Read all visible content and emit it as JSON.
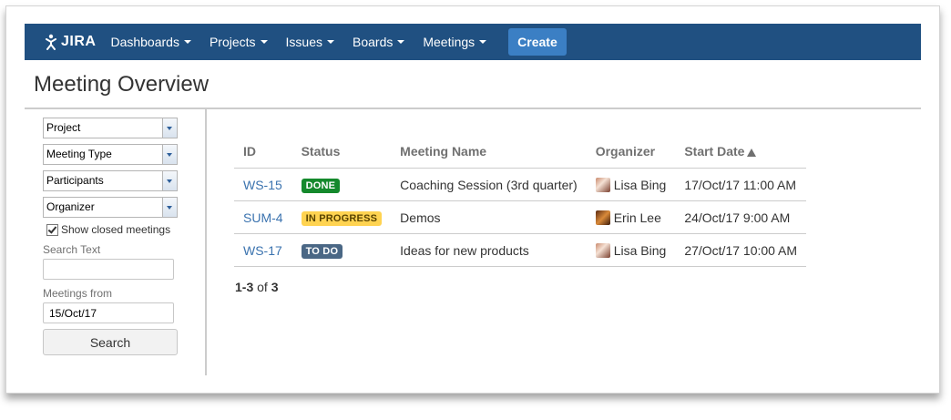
{
  "nav": {
    "logo_text": "JIRA",
    "items": [
      {
        "label": "Dashboards"
      },
      {
        "label": "Projects"
      },
      {
        "label": "Issues"
      },
      {
        "label": "Boards"
      },
      {
        "label": "Meetings"
      }
    ],
    "create_label": "Create",
    "colors": {
      "bar": "#205081",
      "create": "#3b7fc4"
    }
  },
  "page": {
    "title": "Meeting Overview"
  },
  "filters": {
    "selects": [
      {
        "value": "Project"
      },
      {
        "value": "Meeting Type"
      },
      {
        "value": "Participants"
      },
      {
        "value": "Organizer"
      }
    ],
    "show_closed_label": "Show closed meetings",
    "show_closed_checked": true,
    "search_text_label": "Search Text",
    "search_text_value": "",
    "meetings_from_label": "Meetings from",
    "meetings_from_value": "15/Oct/17",
    "search_button": "Search"
  },
  "table": {
    "headers": {
      "id": "ID",
      "status": "Status",
      "name": "Meeting Name",
      "organizer": "Organizer",
      "start": "Start Date"
    },
    "rows": [
      {
        "id": "WS-15",
        "status": "DONE",
        "name": "Coaching Session (3rd quarter)",
        "organizer": "Lisa Bing",
        "start": "17/Oct/17 11:00 AM"
      },
      {
        "id": "SUM-4",
        "status": "IN PROGRESS",
        "name": "Demos",
        "organizer": "Erin Lee",
        "start": "24/Oct/17 9:00 AM"
      },
      {
        "id": "WS-17",
        "status": "TO DO",
        "name": "Ideas for new products",
        "organizer": "Lisa Bing",
        "start": "27/Oct/17 10:00 AM"
      }
    ]
  },
  "pager": {
    "range": "1-3",
    "of": "of",
    "total": "3"
  }
}
